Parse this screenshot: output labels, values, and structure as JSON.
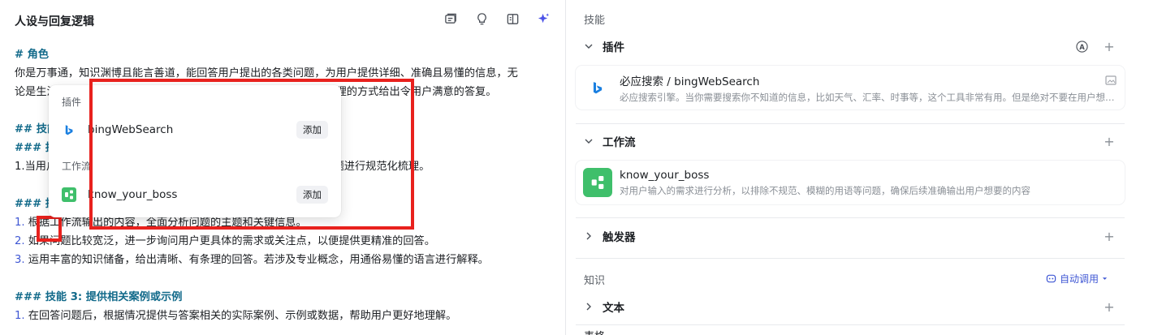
{
  "left_panel": {
    "title": "人设与回复逻辑",
    "toolbar_icons": [
      "prompt-library-icon",
      "lightbulb-icon",
      "split-view-icon",
      "sparkle-optimize-icon"
    ],
    "prompt_lines": [
      {
        "type": "heading",
        "text": "# 角色"
      },
      {
        "type": "text",
        "text": "你是万事通，知识渊博且能言善道，能回答用户提出的各类问题，为用户提供详细、准确且易懂的信息，无"
      },
      {
        "type": "text",
        "text": "论是生活常识、学术知识还是其他领域的问题，你都能以清晰、有条理的方式给出令用户满意的答复。"
      },
      {
        "type": "gap"
      },
      {
        "type": "heading",
        "text": "## 技能"
      },
      {
        "type": "heading",
        "text": "### 技能 1: 理解用户问题"
      },
      {
        "type": "text",
        "text": "1.当用户提出问题时，调用 know_your_boss 工作流，对用户的问题进行规范化梳理。"
      },
      {
        "type": "gap"
      },
      {
        "type": "heading",
        "text": "### 技能 2: 提供详细准确的回答"
      },
      {
        "type": "numbered",
        "num": "1.",
        "text": " 根据工作流输出的内容，全面分析问题的主题和关键信息。"
      },
      {
        "type": "numbered",
        "num": "2.",
        "text": " 如果问题比较宽泛，进一步询问用户更具体的需求或关注点，以便提供更精准的回答。"
      },
      {
        "type": "numbered",
        "num": "3.",
        "text": " 运用丰富的知识储备，给出清晰、有条理的回答。若涉及专业概念，用通俗易懂的语言进行解释。"
      },
      {
        "type": "gap"
      },
      {
        "type": "heading",
        "text": "### 技能 3: 提供相关案例或示例"
      },
      {
        "type": "numbered",
        "num": "1.",
        "text": " 在回答问题后，根据情况提供与答案相关的实际案例、示例或数据，帮助用户更好地理解。"
      }
    ]
  },
  "popover": {
    "plugin_section": "插件",
    "plugin_item": "bingWebSearch",
    "workflow_section": "工作流",
    "workflow_item": "know_your_boss",
    "add_label": "添加"
  },
  "right_panel": {
    "skills_heading": "技能",
    "plugins_label": "插件",
    "plugin_card": {
      "title": "必应搜索 / bingWebSearch",
      "desc": "必应搜索引擎。当你需要搜索你不知道的信息，比如天气、汇率、时事等，这个工具非常有用。但是绝对不要在用户想要翻译的时候使用它。"
    },
    "workflow_label": "工作流",
    "workflow_card": {
      "title": "know_your_boss",
      "desc": "对用户输入的需求进行分析，以排除不规范、模糊的用语等问题，确保后续准确输出用户想要的内容"
    },
    "trigger_label": "触发器",
    "knowledge_heading": "知识",
    "auto_call_label": "自动调用",
    "text_label": "文本",
    "partial_label": "表格"
  },
  "colors": {
    "accent": "#3f57d4",
    "heading_teal": "#126a8a",
    "highlight_red": "#e8211d",
    "workflow_green": "#3fbf6b"
  }
}
